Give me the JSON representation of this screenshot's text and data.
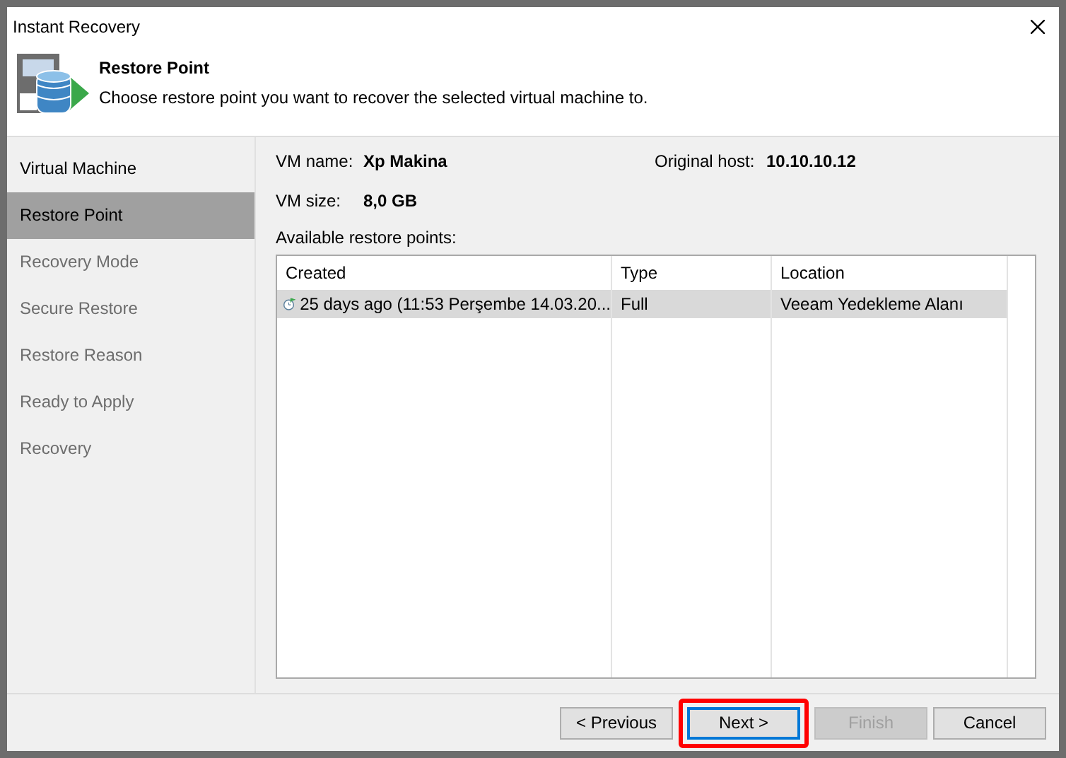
{
  "window": {
    "title": "Instant Recovery"
  },
  "header": {
    "title": "Restore Point",
    "subtitle": "Choose restore point you want to recover the selected virtual machine to."
  },
  "steps": [
    {
      "label": "Virtual Machine",
      "selected": false,
      "disabled": false
    },
    {
      "label": "Restore Point",
      "selected": true,
      "disabled": false
    },
    {
      "label": "Recovery Mode",
      "selected": false,
      "disabled": true
    },
    {
      "label": "Secure Restore",
      "selected": false,
      "disabled": true
    },
    {
      "label": "Restore Reason",
      "selected": false,
      "disabled": true
    },
    {
      "label": "Ready to Apply",
      "selected": false,
      "disabled": true
    },
    {
      "label": "Recovery",
      "selected": false,
      "disabled": true
    }
  ],
  "vm": {
    "name_label": "VM name:",
    "name": "Xp Makina",
    "host_label": "Original host:",
    "host": "10.10.10.12",
    "size_label": "VM size:",
    "size": "8,0 GB"
  },
  "restore_points": {
    "label": "Available restore points:",
    "columns": [
      "Created",
      "Type",
      "Location"
    ],
    "rows": [
      {
        "cells": [
          "25 days ago (11:53 Perşembe 14.03.20...",
          "Full",
          "Veeam Yedekleme Alanı"
        ],
        "selected": true
      }
    ]
  },
  "buttons": [
    {
      "label": "< Previous",
      "disabled": false,
      "highlighted": false
    },
    {
      "label": "Next >",
      "disabled": false,
      "highlighted": true
    },
    {
      "label": "Finish",
      "disabled": true,
      "highlighted": false
    },
    {
      "label": "Cancel",
      "disabled": false,
      "highlighted": false
    }
  ]
}
